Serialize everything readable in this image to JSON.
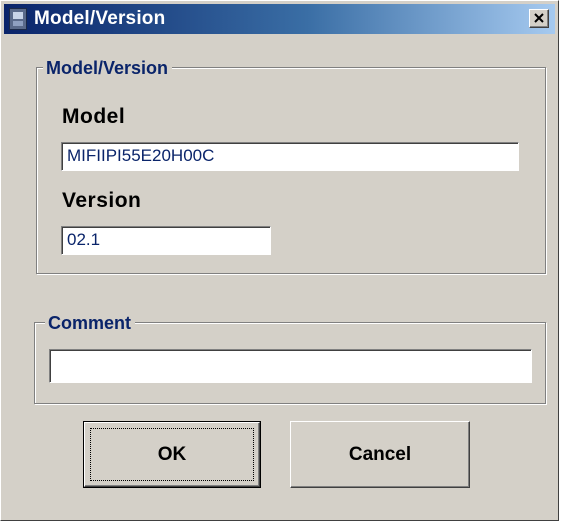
{
  "window": {
    "title": "Model/Version"
  },
  "icons": {
    "app": "application-icon",
    "close": "close-icon"
  },
  "model_version_group": {
    "legend": "Model/Version",
    "model_label": "Model",
    "model_value": "MIFIIPI55E20H00C",
    "version_label": "Version",
    "version_value": "02.1"
  },
  "comment_group": {
    "legend": "Comment",
    "comment_value": ""
  },
  "buttons": {
    "ok_label": "OK",
    "cancel_label": "Cancel"
  },
  "colors": {
    "title_gradient_start": "#0a246a",
    "title_gradient_end": "#a6caf0",
    "face": "#d4d0c8",
    "legend_text": "#0a246a",
    "field_text": "#0a246a"
  }
}
